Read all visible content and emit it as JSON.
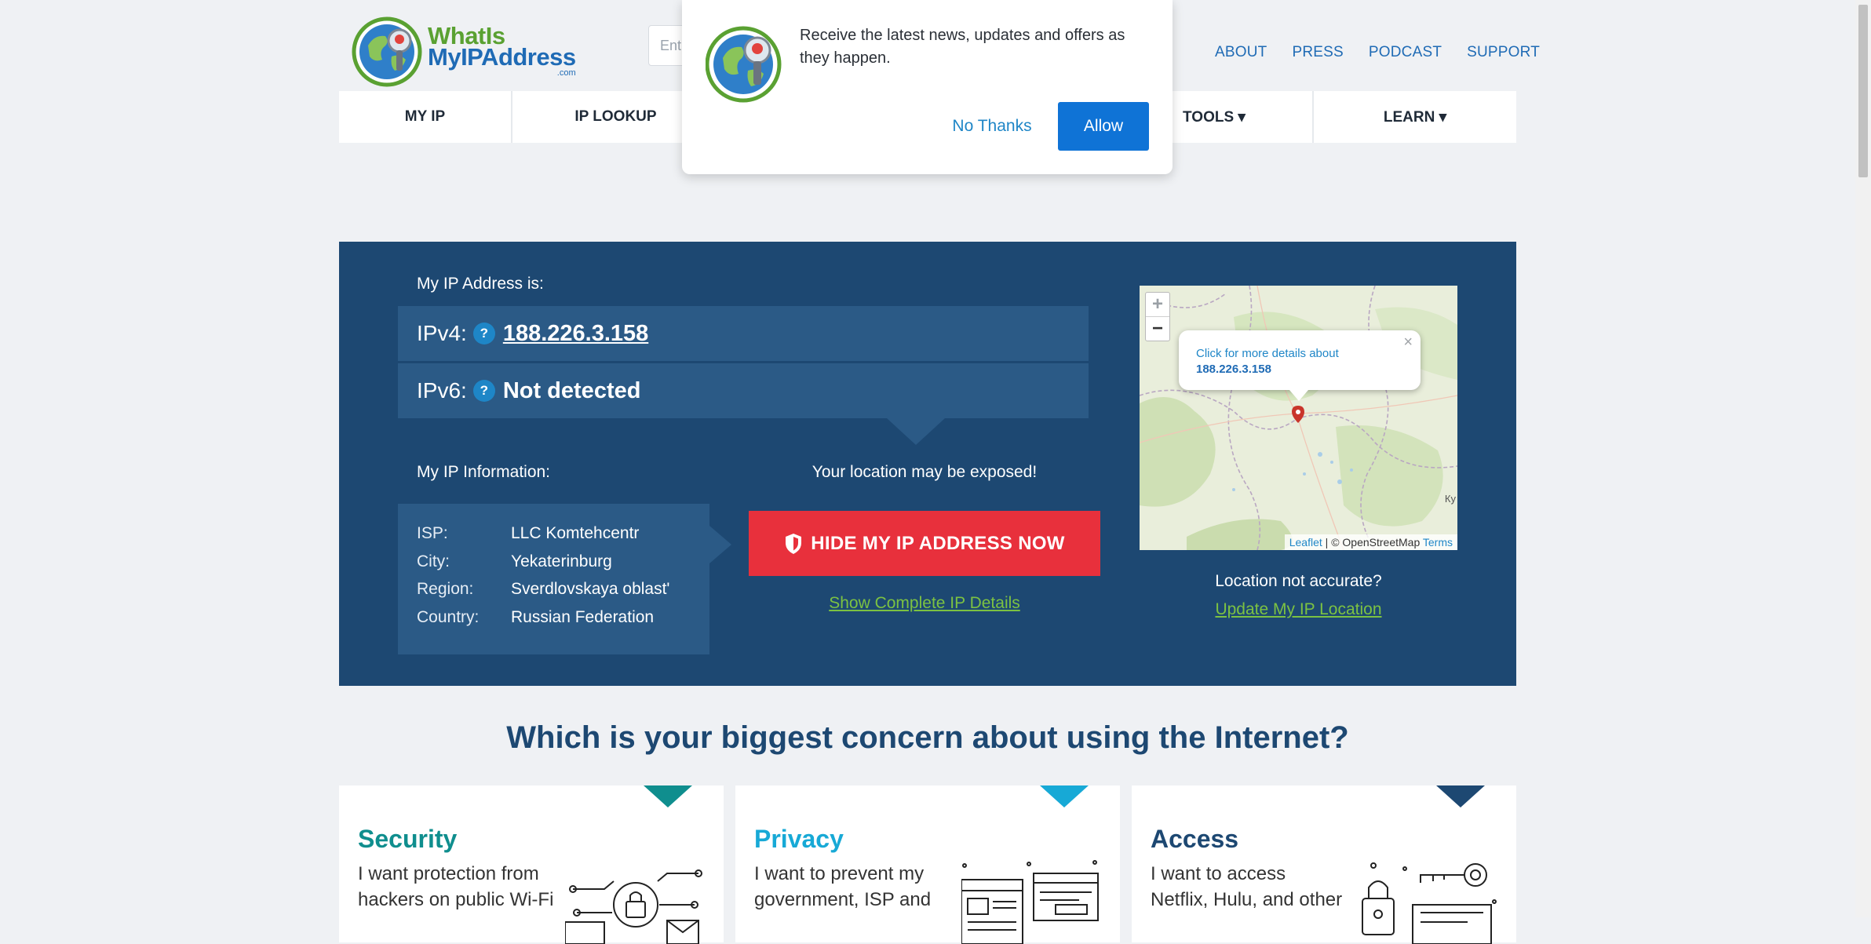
{
  "logo": {
    "line1": "WhatIs",
    "line2": "MyIPAddress",
    "line3": ".com"
  },
  "search": {
    "placeholder": "Ent"
  },
  "top_links": [
    "ABOUT",
    "PRESS",
    "PODCAST",
    "SUPPORT"
  ],
  "nav": {
    "my_ip": "MY IP",
    "ip_lookup": "IP LOOKUP",
    "tools": "TOOLS ▾",
    "learn": "LEARN ▾"
  },
  "notification": {
    "message": "Receive the latest news, updates and offers as they happen.",
    "no_thanks": "No Thanks",
    "allow": "Allow"
  },
  "ip_panel": {
    "heading": "My IP Address is:",
    "ipv4_label": "IPv4:",
    "ipv4_value": "188.226.3.158",
    "ipv6_label": "IPv6:",
    "ipv6_value": "Not detected",
    "help_icon": "?",
    "info_heading": "My IP Information:",
    "info": [
      {
        "key": "ISP:",
        "value": "LLC Komtehcentr"
      },
      {
        "key": "City:",
        "value": "Yekaterinburg"
      },
      {
        "key": "Region:",
        "value": "Sverdlovskaya oblast'"
      },
      {
        "key": "Country:",
        "value": "Russian Federation"
      }
    ],
    "exposed_text": "Your location may be exposed!",
    "hide_button": "HIDE MY IP ADDRESS NOW",
    "show_details": "Show Complete IP Details",
    "location_question": "Location not accurate?",
    "update_location": "Update My IP Location"
  },
  "map": {
    "zoom_in": "+",
    "zoom_out": "−",
    "popup_line1": "Click for more details about",
    "popup_line2": "188.226.3.158",
    "popup_close": "×",
    "map_label": "Ку",
    "attribution_leaflet": "Leaflet",
    "attribution_osm": " | © OpenStreetMap ",
    "attribution_terms": "Terms"
  },
  "concern": {
    "title": "Which is your biggest concern about using the Internet?",
    "cards": [
      {
        "title": "Security",
        "desc": "I want protection from hackers on public Wi-Fi",
        "color": "#0f8e8e"
      },
      {
        "title": "Privacy",
        "desc": "I want to prevent my government, ISP and",
        "color": "#17a9d6"
      },
      {
        "title": "Access",
        "desc": "I want to access Netflix, Hulu, and other",
        "color": "#1d4872"
      }
    ]
  },
  "colors": {
    "panel": "#1d4872",
    "panel_row": "#2b5a86",
    "hide_button": "#e8303c",
    "link_green": "#7cc242",
    "link_blue": "#1f6bb5"
  }
}
